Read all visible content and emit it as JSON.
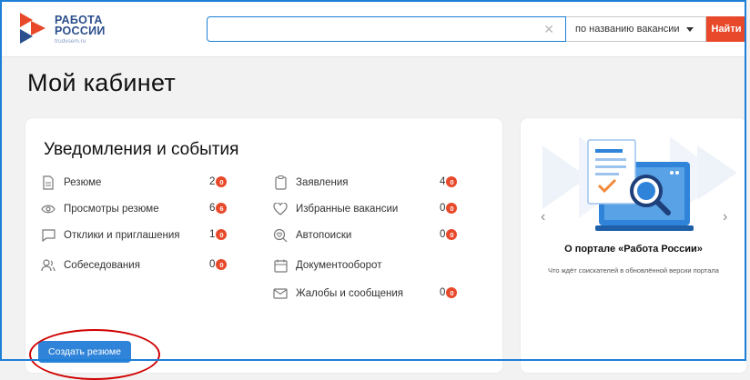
{
  "header": {
    "logo_line1": "РАБОТА",
    "logo_line2": "РОССИИ",
    "logo_sub": "trudvsem.ru",
    "search_placeholder": "",
    "search_clear_icon": "close-icon",
    "search_mode": "по названию вакансии",
    "search_button": "Найти"
  },
  "page": {
    "title": "Мой кабинет"
  },
  "notifications": {
    "title": "Уведомления и события",
    "left": [
      {
        "label": "Резюме",
        "icon": "document-icon",
        "count": "2",
        "badge": "0"
      },
      {
        "label": "Просмотры резюме",
        "icon": "eye-icon",
        "count": "6",
        "badge": "6"
      },
      {
        "label": "Отклики и приглашения",
        "icon": "chat-icon",
        "count": "1",
        "badge": "0"
      },
      {
        "label": "Собеседования",
        "icon": "users-icon",
        "count": "0",
        "badge": "0"
      }
    ],
    "right": [
      {
        "label": "Заявления",
        "icon": "clipboard-icon",
        "count": "4",
        "badge": "0"
      },
      {
        "label": "Избранные вакансии",
        "icon": "heart-icon",
        "count": "0",
        "badge": "0"
      },
      {
        "label": "Автопоиски",
        "icon": "search-heart-icon",
        "count": "0",
        "badge": "0"
      },
      {
        "label": "Документооборот",
        "icon": "calendar-icon",
        "count": "",
        "badge": ""
      },
      {
        "label": "Жалобы и сообщения",
        "icon": "mail-icon",
        "count": "0",
        "badge": "0"
      }
    ],
    "create_button": "Создать резюме"
  },
  "portal": {
    "title": "О портале «Работа России»",
    "description": "Что ждёт соискателей в обновлённой версии портала",
    "prev_icon": "chevron-left-icon",
    "next_icon": "chevron-right-icon"
  },
  "colors": {
    "accent": "#2f84d9",
    "badge": "#e8492a",
    "brand": "#2b4e8c"
  }
}
